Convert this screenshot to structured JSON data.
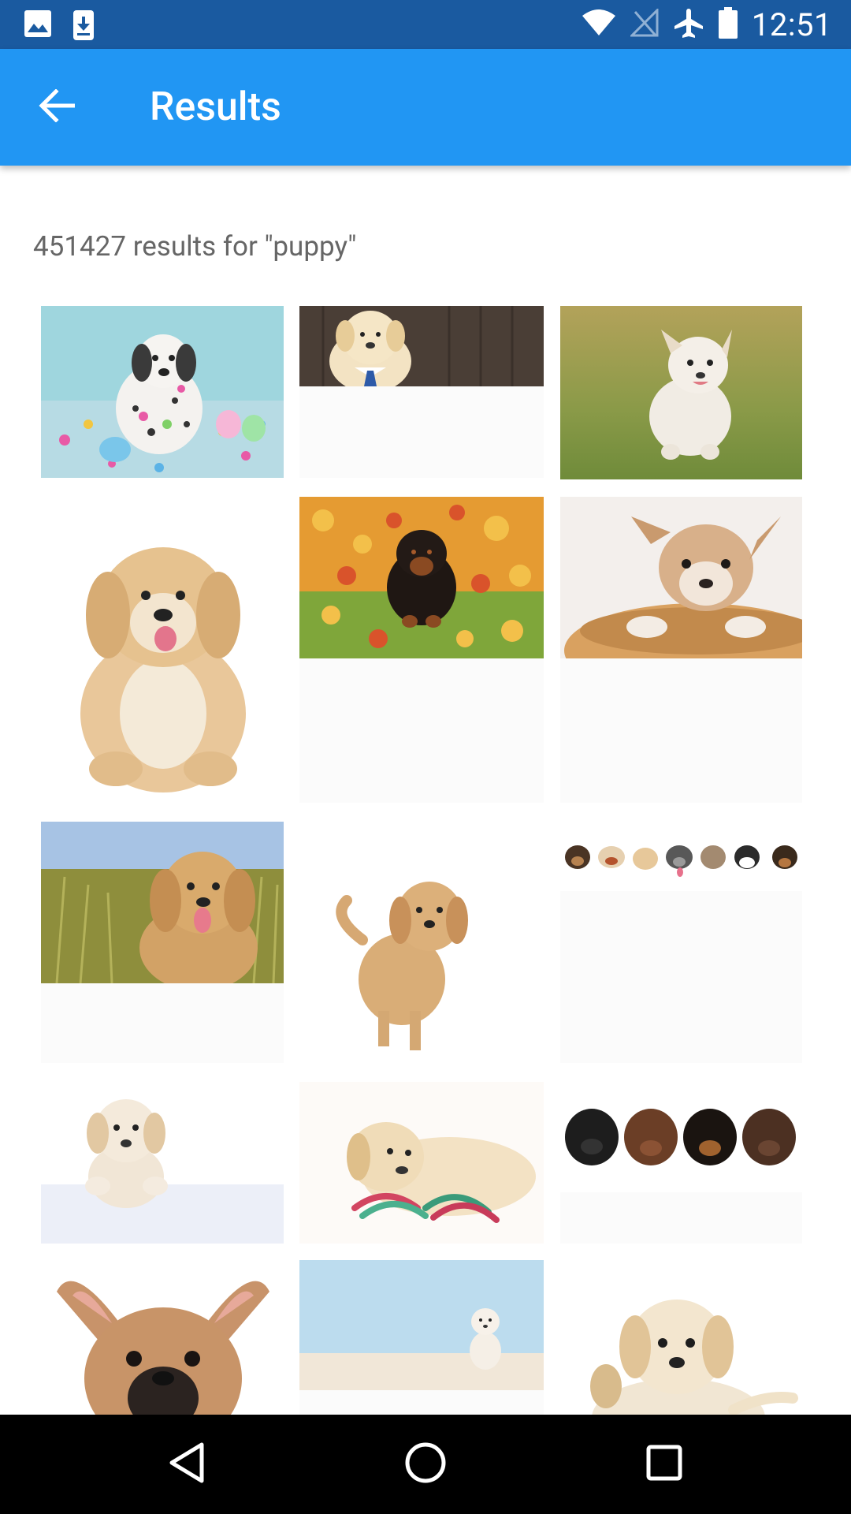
{
  "status_bar": {
    "time": "12:51",
    "left_icons": [
      "image-icon",
      "download-icon"
    ],
    "right_icons": [
      "wifi-icon",
      "no-signal-icon",
      "airplane-icon",
      "battery-icon"
    ]
  },
  "app_bar": {
    "title": "Results",
    "back_icon": "back-arrow-icon",
    "color": "#2196f3"
  },
  "results": {
    "summary": "451427 results for \"puppy\""
  },
  "grid": {
    "tiles": [
      {
        "name": "dalmatian-paint-puppy"
      },
      {
        "name": "labrador-puppy-tie"
      },
      {
        "name": "white-puppy-running-grass"
      },
      {
        "name": "fluffy-tan-puppy-sitting"
      },
      {
        "name": "rottweiler-puppy-autumn-leaves"
      },
      {
        "name": "chihuahua-puppy-basket"
      },
      {
        "name": "golden-retriever-puppy-grass"
      },
      {
        "name": "golden-puppy-walking"
      },
      {
        "name": "puppies-and-kittens-row"
      },
      {
        "name": "labrador-puppy-over-sign"
      },
      {
        "name": "labrador-puppy-rope-toy"
      },
      {
        "name": "four-puppies-row"
      },
      {
        "name": "french-bulldog-puppy"
      },
      {
        "name": "white-puppy-blue-wall"
      },
      {
        "name": "labrador-puppy-waving"
      }
    ]
  },
  "nav_bar": {
    "buttons": [
      "back-triangle-icon",
      "home-circle-icon",
      "recents-square-icon"
    ]
  }
}
